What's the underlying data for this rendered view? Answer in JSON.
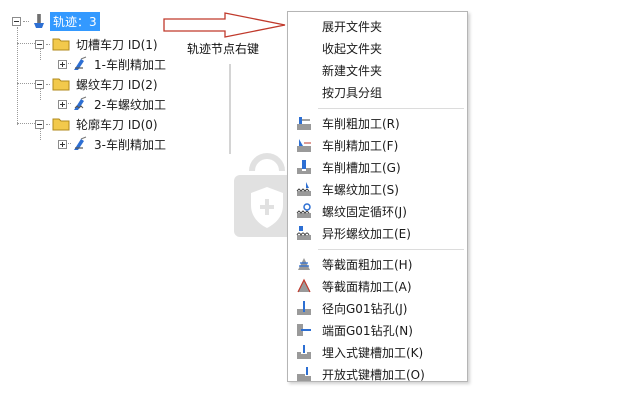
{
  "tree": {
    "root": {
      "label": "轨迹：3",
      "selected": true
    },
    "groups": [
      {
        "label": "切槽车刀 ID(1)",
        "child": "1-车削精加工"
      },
      {
        "label": "螺纹车刀 ID(2)",
        "child": "2-车螺纹加工"
      },
      {
        "label": "轮廓车刀 ID(0)",
        "child": "3-车削精加工"
      }
    ]
  },
  "annotation": {
    "text": "轨迹节点右键"
  },
  "menu": {
    "group1": [
      "展开文件夹",
      "收起文件夹",
      "新建文件夹",
      "按刀具分组"
    ],
    "group2": [
      "车削粗加工(R)",
      "车削精加工(F)",
      "车削槽加工(G)",
      "车螺纹加工(S)",
      "螺纹固定循环(J)",
      "异形螺纹加工(E)"
    ],
    "group3": [
      "等截面粗加工(H)",
      "等截面精加工(A)",
      "径向G01钻孔(J)",
      "端面G01钻孔(N)",
      "埋入式键槽加工(K)",
      "开放式键槽加工(O)"
    ]
  },
  "colors": {
    "selection": "#3399ff",
    "arrow": "#c0392b",
    "folder": "#f2c94c"
  }
}
